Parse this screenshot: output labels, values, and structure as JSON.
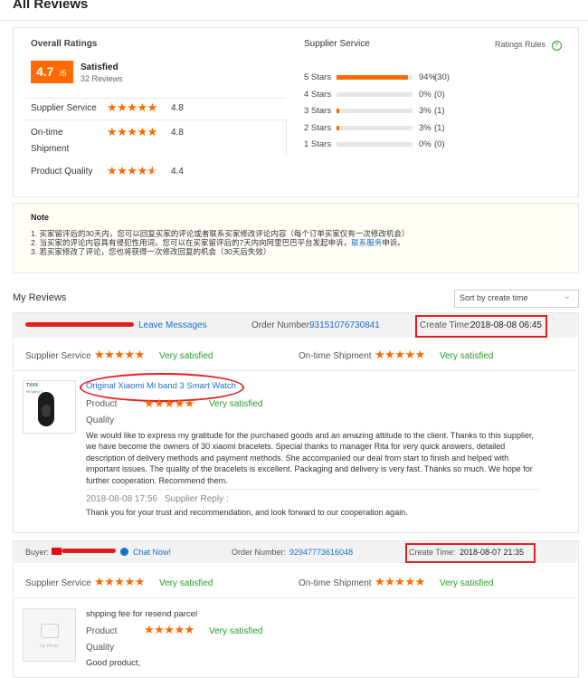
{
  "page_title": "All Reviews",
  "overall": {
    "heading": "Overall Ratings",
    "score": "4.7",
    "score_max": "/5",
    "label": "Satisfied",
    "reviews_count": "32 Reviews",
    "rows": [
      {
        "label": "Supplier Service",
        "value": "4.8",
        "stars": 5
      },
      {
        "label": "On-time Shipment",
        "value": "4.8",
        "stars": 5
      },
      {
        "label": "Product Quality",
        "value": "4.4",
        "stars": 4.5
      }
    ]
  },
  "supplier_service": {
    "heading": "Supplier Service",
    "rules_link": "Ratings Rules",
    "rows": [
      {
        "label": "5 Stars",
        "pct": "94%",
        "count": "(30)",
        "fill": 0.94
      },
      {
        "label": "4 Stars",
        "pct": "0%",
        "count": "(0)",
        "fill": 0
      },
      {
        "label": "3 Stars",
        "pct": "3%",
        "count": "(1)",
        "fill": 0.03
      },
      {
        "label": "2 Stars",
        "pct": "3%",
        "count": "(1)",
        "fill": 0.03
      },
      {
        "label": "1 Stars",
        "pct": "0%",
        "count": "(0)",
        "fill": 0
      }
    ]
  },
  "note": {
    "heading": "Note",
    "line1": "1. 买家留评后的30天内，您可以回复买家的评论或者联系买家修改评论内容（每个订单买家仅有一次修改机会）",
    "line2_pre": "2. 当买家的评论内容具有侵犯性用词，您可以在买家留评后的7天内向阿里巴巴平台发起申诉，",
    "line2_link": "联系服务",
    "line2_post": "申诉。",
    "line3": "3. 若买家修改了评论，您也将获得一次修改回复的机会（30天后失效）"
  },
  "my_reviews": {
    "heading": "My Reviews",
    "sort_label": "Sort by create time"
  },
  "review1": {
    "leave_messages": "Leave Messages",
    "order_label": "Order Number:",
    "order_number": "93151076730841",
    "create_label": "Create Time:",
    "create_time": "2018-08-08 06:45",
    "supplier_label": "Supplier Service",
    "supplier_rating": "Very satisfied",
    "shipment_label": "On-time Shipment",
    "shipment_rating": "Very satisfied",
    "product_title": "Original Xiaomi Mi band 3 Smart Watch",
    "product_quality_label_1": "Product",
    "product_quality_label_2": "Quality",
    "product_rating": "Very satisfied",
    "body": "We would like to express my gratitude for the purchased goods and an amazing attitude to the client. Thanks to this supplier, we have become the owners of 30 xiaomi bracelets. Special thanks to manager Rita for very quick answers, detailed description of delivery methods and payment methods. She accompanied our deal from start to finish and helped with important issues. The quality of the bracelets is excellent. Packaging and delivery is very fast. Thanks so much. We hope for further cooperation. Recommend them.",
    "reply_date": "2018-08-08 17:56",
    "reply_label": "Supplier Reply :",
    "reply_text": "Thank you for your trust and recommendation, and look forward to our cooperation again.",
    "thumb_caption_1": "TXXX",
    "thumb_caption_2": "Mi Band 3"
  },
  "review2": {
    "buyer_label": "Buyer:",
    "chat_now": "Chat Now!",
    "order_label": "Order Number:",
    "order_number": "92947773616048",
    "create_label": "Create Time:",
    "create_time": "2018-08-07 21:35",
    "supplier_label": "Supplier Service",
    "supplier_rating": "Very satisfied",
    "shipment_label": "On-time Shipment",
    "shipment_rating": "Very satisfied",
    "product_title": "shpping fee for resend parcel",
    "product_quality_label_1": "Product",
    "product_quality_label_2": "Quality",
    "product_rating": "Very satisfied",
    "body": "Good product,",
    "no_photo": "No Photo"
  },
  "colors": {
    "accent": "#ff6a00",
    "link": "#1a6fc9",
    "success": "#2a9d2a",
    "annotation": "#e02020"
  }
}
